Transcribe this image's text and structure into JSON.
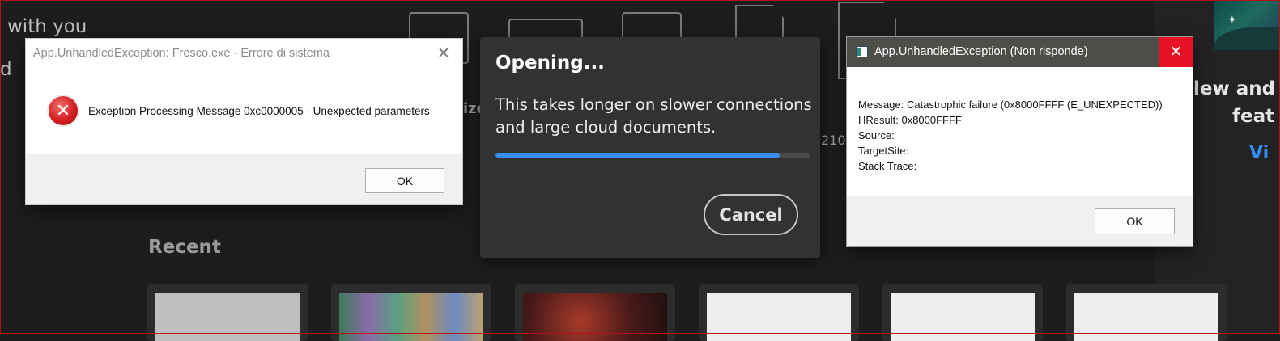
{
  "background": {
    "welcome_fragment_1": "with you",
    "welcome_fragment_2": "d",
    "size_fragment": "ize",
    "dimension_fragment": "210",
    "recent_title": "Recent",
    "side_title_line1": "lew and",
    "side_title_line2": "feat",
    "side_link": "Vi"
  },
  "error_dialog": {
    "title": "App.UnhandledException: Fresco.exe - Errore di sistema",
    "close_glyph": "✕",
    "error_glyph": "✕",
    "message": "Exception Processing Message 0xc0000005 - Unexpected parameters",
    "ok_label": "OK"
  },
  "opening_dialog": {
    "title": "Opening...",
    "body_line1": "This takes longer on slower connections",
    "body_line2": "and large cloud documents.",
    "progress": 0.905,
    "cancel_label": "Cancel",
    "accent_color": "#378ef0"
  },
  "not_responding_dialog": {
    "title": "App.UnhandledException (Non risponde)",
    "close_glyph": "✕",
    "lines": [
      "Message: Catastrophic failure (0x8000FFFF (E_UNEXPECTED))",
      "HResult: 0x8000FFFF",
      "Source:",
      "TargetSite:",
      "Stack Trace:"
    ],
    "ok_label": "OK"
  },
  "colors": {
    "app_background": "#1d1d1d",
    "close_button_red": "#e81123",
    "link_blue": "#2f8ff2"
  }
}
